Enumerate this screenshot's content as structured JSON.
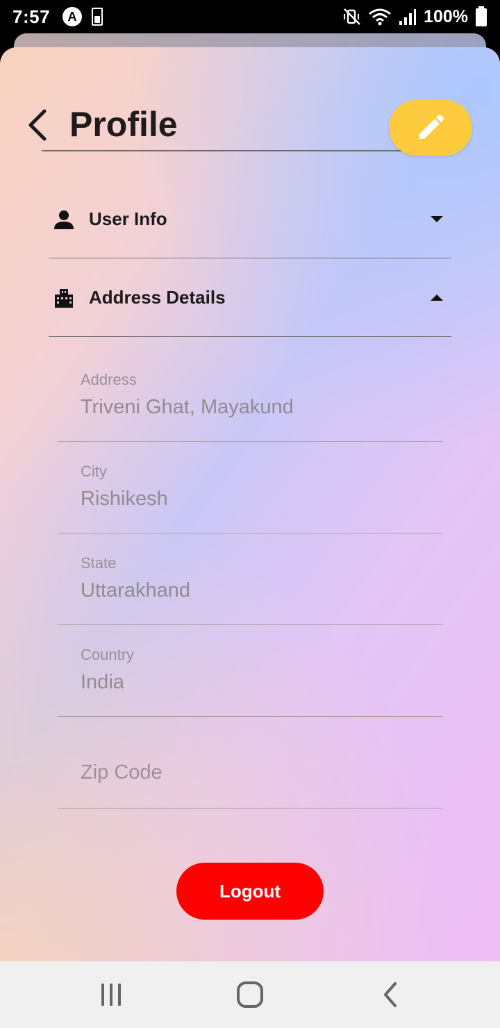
{
  "status_bar": {
    "time": "7:57",
    "battery_percent": "100%",
    "app_icon_letter": "A",
    "icons": [
      "a-app-icon",
      "battery-small-icon",
      "mute-vibrate-icon",
      "wifi-icon",
      "signal-icon",
      "battery-icon"
    ]
  },
  "header": {
    "title": "Profile",
    "back_icon": "chevron-left-icon",
    "edit_icon": "pencil-icon"
  },
  "accordions": [
    {
      "label": "User Info",
      "icon": "person-icon",
      "state": "collapsed"
    },
    {
      "label": "Address Details",
      "icon": "building-icon",
      "state": "expanded"
    }
  ],
  "address_fields": [
    {
      "label": "Address",
      "value": "Triveni Ghat, Mayakund"
    },
    {
      "label": "City",
      "value": "Rishikesh"
    },
    {
      "label": "State",
      "value": "Uttarakhand"
    },
    {
      "label": "Country",
      "value": "India"
    },
    {
      "label": "",
      "value": "",
      "placeholder": "Zip Code"
    }
  ],
  "logout_label": "Logout",
  "colors": {
    "edit_button": "#ffcb3e",
    "logout_button": "#ff0000"
  },
  "nav_bar": {
    "icons": [
      "recent-apps-icon",
      "home-icon",
      "back-icon"
    ]
  }
}
